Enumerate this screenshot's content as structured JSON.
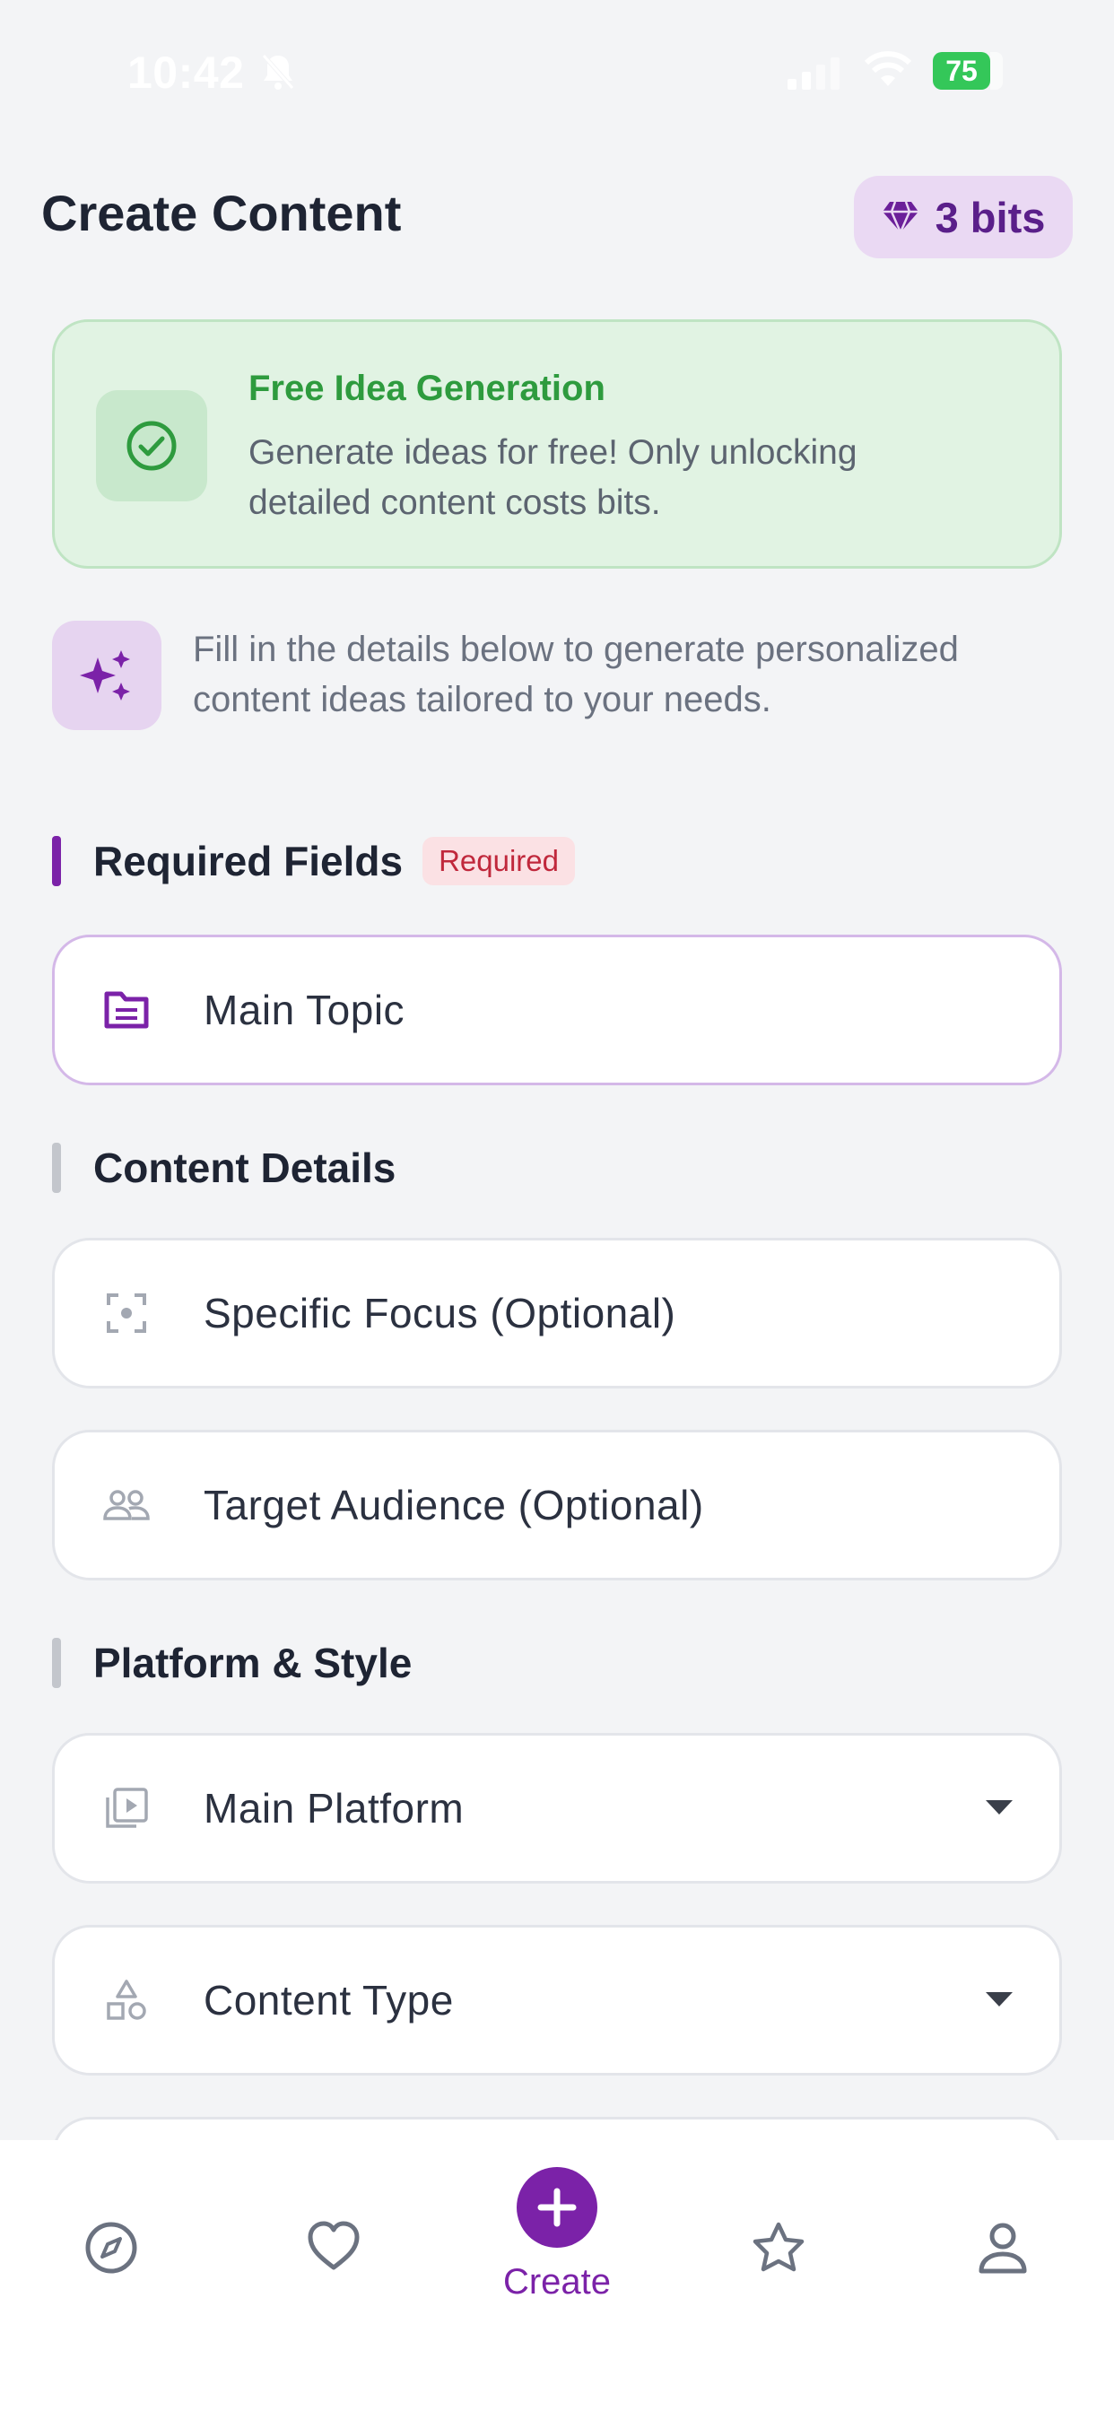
{
  "status_bar": {
    "time": "10:42",
    "battery": "75"
  },
  "header": {
    "title": "Create Content",
    "bits": "3 bits"
  },
  "free_card": {
    "title": "Free Idea Generation",
    "description": "Generate ideas for free! Only unlocking detailed content costs bits."
  },
  "tip": {
    "text": "Fill in the details below to generate personalized content ideas tailored to your needs."
  },
  "sections": {
    "required": {
      "title": "Required Fields",
      "badge": "Required"
    },
    "details": {
      "title": "Content Details"
    },
    "platform": {
      "title": "Platform & Style"
    }
  },
  "fields": {
    "main_topic": "Main Topic",
    "specific_focus": "Specific Focus (Optional)",
    "target_audience": "Target Audience (Optional)",
    "main_platform": "Main Platform",
    "content_type": "Content Type"
  },
  "nav": {
    "create_label": "Create"
  },
  "colors": {
    "accent": "#7b22a8",
    "success": "#2e9b3e",
    "required": "#c0283c",
    "background": "#f3f4f6"
  },
  "icons": {
    "bits": "diamond-icon",
    "free": "check-circle-icon",
    "tip": "sparkles-icon",
    "main_topic": "document-icon",
    "specific_focus": "focus-icon",
    "target_audience": "people-icon",
    "main_platform": "video-library-icon",
    "content_type": "shapes-icon",
    "nav": [
      "compass-icon",
      "heart-icon",
      "plus-icon",
      "star-icon",
      "person-icon"
    ]
  }
}
